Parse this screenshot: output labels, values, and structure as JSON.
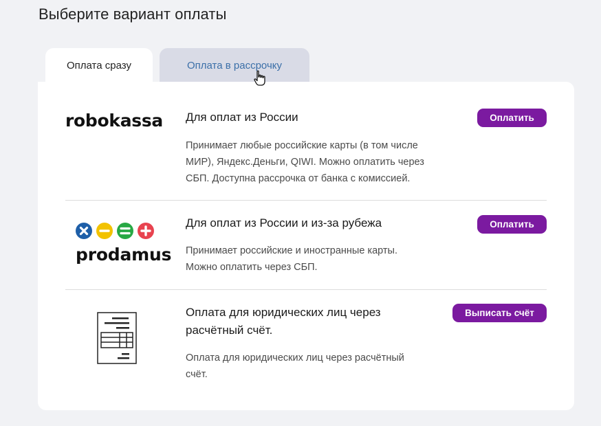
{
  "heading": "Выберите вариант оплаты",
  "tabs": {
    "active": "Оплата сразу",
    "inactive": "Оплата в рассрочку"
  },
  "methods": [
    {
      "logo_text": "robokassa",
      "title": "Для оплат из России",
      "desc_lines": [
        "Принимает любые российские карты (в том числе",
        "МИР), Яндекс.Деньги, QIWI. Можно оплатить через",
        "СБП. Доступна рассрочка от банка с комиссией."
      ],
      "button": "Оплатить"
    },
    {
      "logo_text": "prodamus",
      "title": "Для оплат из России и из-за рубежа",
      "desc_lines": [
        "Принимает российские и иностранные карты.",
        "Можно оплатить через СБП."
      ],
      "button": "Оплатить"
    },
    {
      "logo_icon": "invoice-document-icon",
      "title_lines": [
        "Оплата для юридических лиц через",
        "расчётный счёт."
      ],
      "desc_lines": [
        "Оплата для юридических лиц через расчётный",
        "счёт."
      ],
      "button": "Выписать счёт"
    }
  ],
  "colors": {
    "button": "#7b1aa0",
    "inactive_tab_bg": "#d9dbe6",
    "inactive_tab_text": "#3b6fa8",
    "prodamus_blue": "#1e5fa8",
    "prodamus_yellow": "#f2c200",
    "prodamus_green": "#27a844",
    "prodamus_red": "#e8434f"
  }
}
